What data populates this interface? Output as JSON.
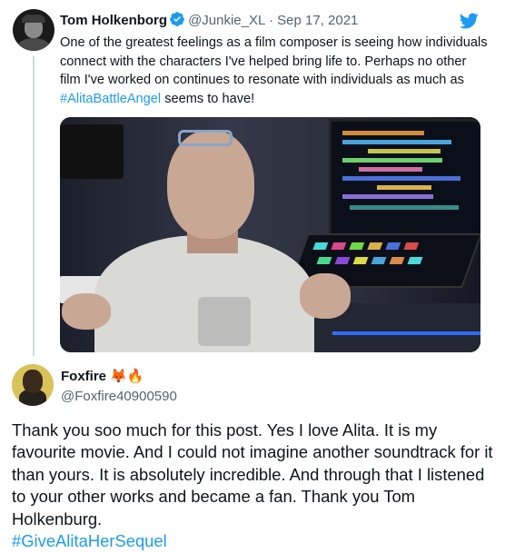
{
  "tweet": {
    "author_name": "Tom Holkenborg",
    "handle": "@Junkie_XL",
    "separator": "·",
    "date": "Sep 17, 2021",
    "text": "One of the greatest feelings as a film composer is seeing how individuals connect with the characters I've helped bring life to. Perhaps no other film I've worked on continues to resonate with individuals as much as ",
    "hashtag": "#AlitaBattleAngel",
    "text_end": " seems to have!",
    "verified_icon": "verified-badge-icon",
    "logo_icon": "twitter-bird-icon",
    "media_desc": "video-still"
  },
  "reply": {
    "author_name": "Foxfire",
    "name_emojis": "🦊🔥",
    "handle": "@Foxfire40900590",
    "text": "Thank you soo much for this post. Yes I love Alita. It is my favourite movie. And I could not imagine another soundtrack for it than yours. It is absolutely incredible. And through that I listened to your other works and became a fan. Thank you Tom Holkenburg.",
    "hashtag": "#GiveAlitaHerSequel"
  },
  "colors": {
    "accent": "#1d9bf0",
    "text": "#0f1419",
    "secondary": "#536471",
    "thread_line": "#cfd9de"
  }
}
